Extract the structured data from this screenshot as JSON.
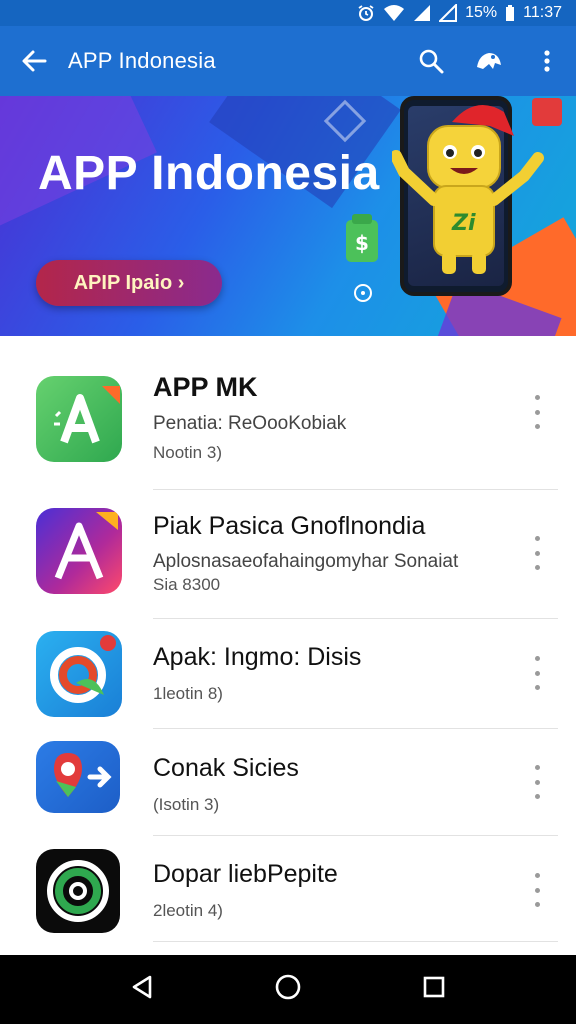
{
  "status_bar": {
    "battery_text": "15%",
    "time": "11:37"
  },
  "app_bar": {
    "title": "APP Indonesia",
    "icons": [
      "back-arrow-icon",
      "search-icon",
      "notification-icon",
      "more-vert-icon"
    ]
  },
  "banner": {
    "title": "APP Indonesia",
    "button_label": "APIP Ipaio ›"
  },
  "apps": [
    {
      "name": "APP MK",
      "description": "Penatia: ReOooKobiak",
      "meta": "Nootin 3)",
      "icon": "green-app-icon",
      "colors": [
        "#2fa84f",
        "#66d16f"
      ]
    },
    {
      "name": "Piak Pasica Gnoflnondia",
      "description": "Aplosnasaeofahaingomyhar Sonaiat",
      "meta": "Sia 8300",
      "icon": "purple-app-icon",
      "colors": [
        "#6b2fd6",
        "#e23b7a"
      ]
    },
    {
      "name": "Apak: Ingmo: Disis",
      "description": "",
      "meta": "1leotin 8)",
      "icon": "blue-circle-app-icon",
      "colors": [
        "#1a9be0",
        "#e44a2a"
      ]
    },
    {
      "name": "Conak Sicies",
      "description": "",
      "meta": "(Isotin 3)",
      "icon": "maps-app-icon",
      "colors": [
        "#1e6fd0",
        "#2fa84f"
      ]
    },
    {
      "name": "Dopar liebPepite",
      "description": "",
      "meta": "2leotin 4)",
      "icon": "dark-circle-app-icon",
      "colors": [
        "#0b0b0b",
        "#2fa84f"
      ]
    }
  ],
  "nav_bar": {
    "icons": [
      "back-triangle-icon",
      "home-circle-icon",
      "recents-square-icon"
    ]
  },
  "colors": {
    "status_bar": "#1565c0",
    "app_bar": "#1e6fd0",
    "nav_bar": "#000000"
  }
}
